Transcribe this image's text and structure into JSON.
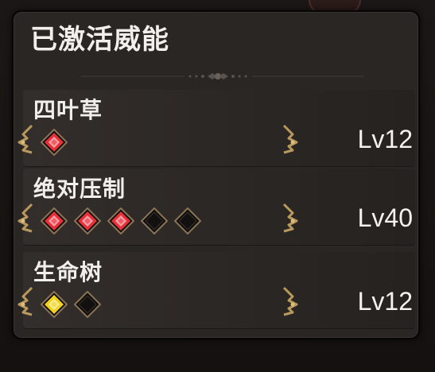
{
  "panel": {
    "title": "已激活威能"
  },
  "rows": [
    {
      "name": "四叶草",
      "level": "Lv12",
      "gems": [
        "red"
      ]
    },
    {
      "name": "绝对压制",
      "level": "Lv40",
      "gems": [
        "red",
        "red",
        "red",
        "empty",
        "empty"
      ]
    },
    {
      "name": "生命树",
      "level": "Lv12",
      "gems": [
        "yellow",
        "empty"
      ]
    }
  ],
  "colors": {
    "gem_red": "#e8303a",
    "gem_yellow": "#f0d21c",
    "gem_empty": "#131110",
    "accent_gold": "#b99a5c",
    "text": "#f2f0ec"
  },
  "icons": {
    "bracket": "ornate-bracket-icon",
    "gem": "diamond-gem-icon",
    "divider": "ornament-divider-icon"
  }
}
